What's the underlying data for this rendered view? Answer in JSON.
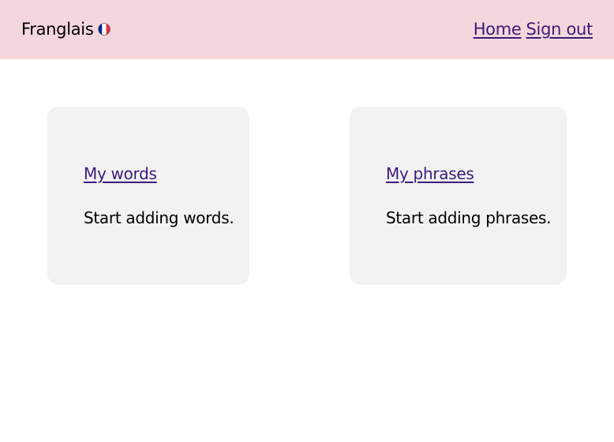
{
  "header": {
    "brand": "Franglais",
    "brand_icon": "french-flag-icon",
    "nav": {
      "home": "Home",
      "sign_out": "Sign out"
    }
  },
  "cards": [
    {
      "title": "My words",
      "text": "Start adding words."
    },
    {
      "title": "My phrases",
      "text": "Start adding phrases."
    }
  ],
  "colors": {
    "header_bg": "#f4d7dc",
    "card_bg": "#f2f2f2",
    "link": "#3d1a78",
    "flag_blue": "#002395",
    "flag_white": "#ffffff",
    "flag_red": "#ed2939"
  }
}
